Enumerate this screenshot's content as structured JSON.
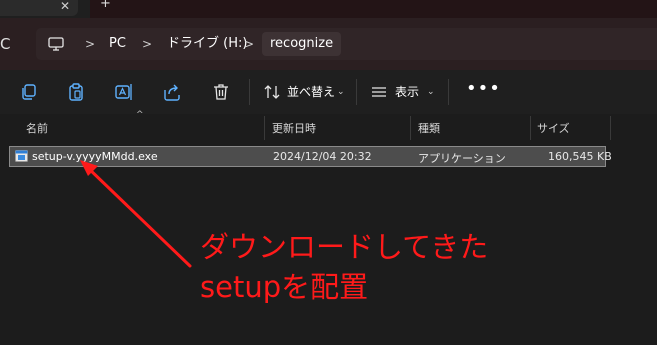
{
  "tabbar": {
    "close_glyph": "✕",
    "new_tab_glyph": "+"
  },
  "nav": {
    "refresh_glyph": "C"
  },
  "breadcrumb": {
    "items": [
      {
        "label": "PC"
      },
      {
        "label": "ドライブ (H:)"
      },
      {
        "label": "recognize"
      }
    ],
    "separator": ">"
  },
  "toolbar": {
    "sort_label": "並べ替え",
    "view_label": "表示",
    "more_glyph": "•••",
    "icons": [
      "copy-icon",
      "paste-icon",
      "rename-icon",
      "share-icon",
      "delete-icon",
      "sort-icon",
      "view-icon",
      "more-icon"
    ]
  },
  "columns": {
    "name": "名前",
    "modified": "更新日時",
    "type": "種類",
    "size": "サイズ"
  },
  "files": [
    {
      "name": "setup-v.yyyyMMdd.exe",
      "modified": "2024/12/04 20:32",
      "type": "アプリケーション",
      "size": "160,545 KB",
      "icon": "exe-icon"
    }
  ],
  "annotation": {
    "line1": "ダウンロードしてきた",
    "line2": "setupを配置",
    "color": "#ff1a1a"
  },
  "colors": {
    "background": "#1c1c1c",
    "address_bg": "#2b1f21",
    "selection": "#4d4d4d",
    "annotation": "#ff1a1a"
  }
}
